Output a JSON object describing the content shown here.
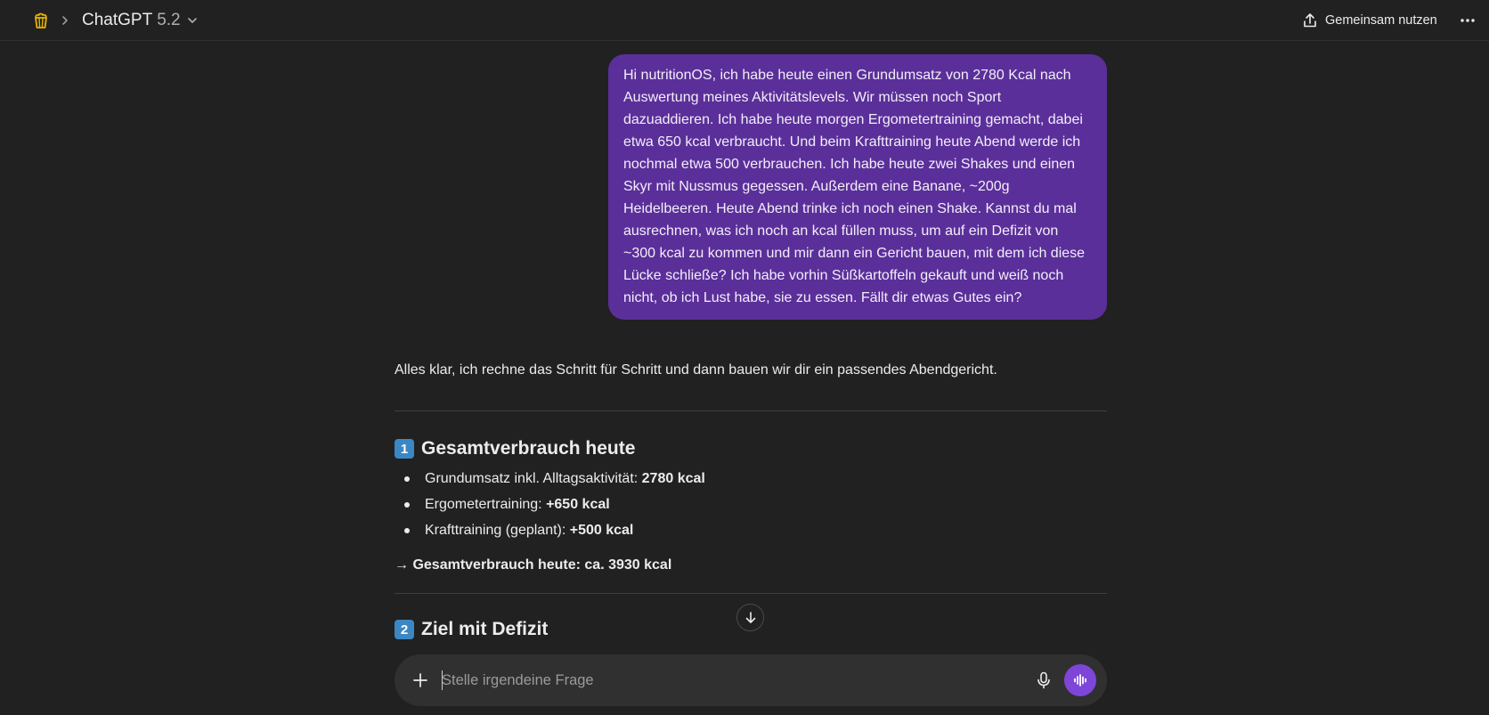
{
  "header": {
    "project_icon": "popcorn-icon",
    "model_name": "ChatGPT",
    "model_version": "5.2",
    "share_label": "Gemeinsam nutzen"
  },
  "user_message": {
    "text": "Hi nutritionOS, ich habe heute einen Grundumsatz von 2780 Kcal nach Auswertung meines Aktivitätslevels. Wir müssen noch Sport dazuaddieren. Ich habe heute morgen Ergometertraining gemacht, dabei etwa 650 kcal verbraucht. Und beim Krafttraining heute Abend werde ich nochmal etwa 500 verbrauchen. Ich habe heute zwei Shakes und einen Skyr mit Nussmus gegessen. Außerdem eine Banane, ~200g Heidelbeeren. Heute Abend trinke ich noch einen Shake. Kannst du mal ausrechnen, was ich noch an kcal füllen muss, um auf ein Defizit von ~300 kcal zu kommen und mir dann ein Gericht bauen, mit dem ich diese Lücke schließe? Ich habe vorhin Süßkartoffeln gekauft und weiß noch nicht, ob ich Lust habe, sie zu essen. Fällt dir etwas Gutes ein?",
    "background": "#5b2f99"
  },
  "assistant": {
    "intro": "Alles klar, ich rechne das Schritt für Schritt und dann bauen wir dir ein passendes Abendgericht.",
    "section1": {
      "number": "1",
      "title": "Gesamtverbrauch heute",
      "items": [
        {
          "label": "Grundumsatz inkl. Alltagsaktivität: ",
          "value": "2780 kcal"
        },
        {
          "label": "Ergometertraining: ",
          "value": "+650 kcal"
        },
        {
          "label": "Krafttraining (geplant): ",
          "value": "+500 kcal"
        }
      ],
      "total": "→ Gesamtverbrauch heute: ca. 3930 kcal"
    },
    "section2": {
      "number": "2",
      "title": "Ziel mit Defizit"
    }
  },
  "composer": {
    "placeholder": "Stelle irgendeine Frage",
    "value": "",
    "voice_button_color": "#7e45d9"
  }
}
